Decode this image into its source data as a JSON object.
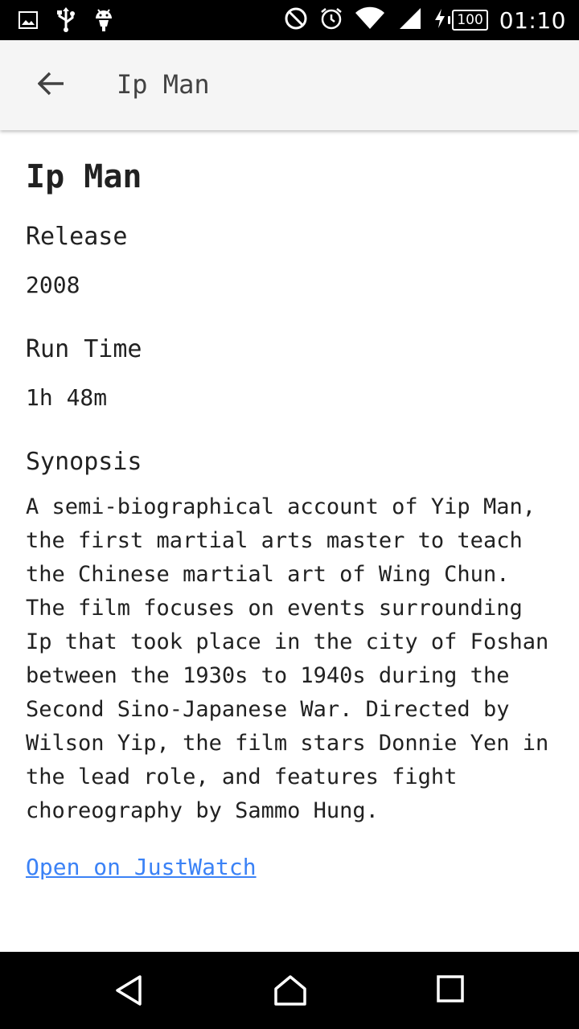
{
  "status_bar": {
    "battery_level": "100",
    "time": "01:10",
    "icons": [
      "image-icon",
      "usb-icon",
      "android-debug-icon",
      "do-not-disturb-icon",
      "alarm-icon",
      "wifi-icon",
      "signal-icon",
      "charging-icon",
      "battery-icon"
    ]
  },
  "app_bar": {
    "title": "Ip Man",
    "back_icon": "arrow-back-icon"
  },
  "movie": {
    "title": "Ip Man",
    "release_label": "Release",
    "release_value": "2008",
    "runtime_label": "Run Time",
    "runtime_value": "1h 48m",
    "synopsis_label": "Synopsis",
    "synopsis": "A semi-biographical account of Yip Man, the first martial arts master to teach the Chinese martial art of Wing Chun. The film focuses on events surrounding Ip that took place in the city of Foshan between the 1930s to 1940s during the Second Sino-Japanese War. Directed by Wilson Yip, the film stars Donnie Yen in the lead role, and features fight choreography by Sammo Hung.",
    "link_text": "Open on JustWatch"
  },
  "colors": {
    "link": "#3b82f6",
    "app_bar_bg": "#f5f5f5",
    "text": "#212121"
  }
}
